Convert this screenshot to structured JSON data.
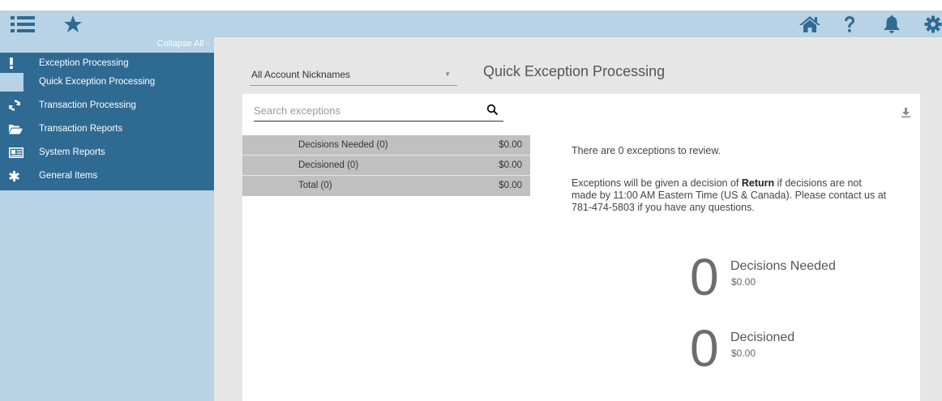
{
  "topbar": {
    "left_icons": [
      "menu-list-icon",
      "star-icon"
    ],
    "right_icons": [
      "home-icon",
      "help-icon",
      "bell-icon",
      "gear-icon"
    ],
    "bg": "#b7d3e5",
    "icon_color": "#2f6a93"
  },
  "sidebar": {
    "collapse_label": "Collapse All -",
    "items": [
      {
        "label": "Exception Processing",
        "icon": "exclamation-icon"
      },
      {
        "label": "Transaction Processing",
        "icon": "refresh-icon"
      },
      {
        "label": "Transaction Reports",
        "icon": "folder-icon"
      },
      {
        "label": "System Reports",
        "icon": "id-card-icon"
      },
      {
        "label": "General Items",
        "icon": "asterisk-icon"
      }
    ],
    "sub_item": {
      "label": "Quick Exception Processing"
    },
    "nav_bg": "#2f6a93"
  },
  "main": {
    "account_select": {
      "value": "All Account Nicknames"
    },
    "title": "Quick Exception Processing",
    "search": {
      "placeholder": "Search exceptions",
      "value": ""
    },
    "summary": [
      {
        "label": "Decisions Needed (0)",
        "amount": "$0.00"
      },
      {
        "label": "Decisioned (0)",
        "amount": "$0.00"
      },
      {
        "label": "Total (0)",
        "amount": "$0.00"
      }
    ],
    "info": {
      "line1": "There are 0 exceptions to review.",
      "p2_prefix": "Exceptions will be given a decision of ",
      "p2_bold": "Return",
      "p2_suffix": " if decisions are not made by 11:00 AM Eastern Time (US & Canada). Please contact us at 781-474-5803 if you have any questions."
    },
    "stats": [
      {
        "count": "0",
        "label": "Decisions Needed",
        "amount": "$0.00"
      },
      {
        "count": "0",
        "label": "Decisioned",
        "amount": "$0.00"
      }
    ]
  }
}
